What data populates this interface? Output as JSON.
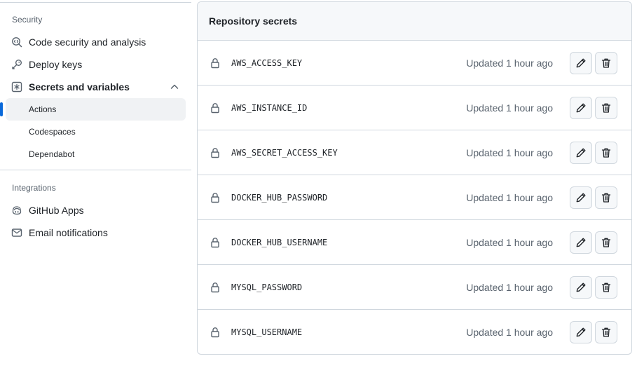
{
  "sidebar": {
    "security_heading": "Security",
    "items": [
      {
        "label": "Code security and analysis",
        "icon": "codescan-icon"
      },
      {
        "label": "Deploy keys",
        "icon": "key-icon"
      },
      {
        "label": "Secrets and variables",
        "icon": "asterisk-square-icon",
        "expanded": true
      },
      {
        "label": "Actions",
        "active": true
      },
      {
        "label": "Codespaces"
      },
      {
        "label": "Dependabot"
      }
    ],
    "integrations_heading": "Integrations",
    "integration_items": [
      {
        "label": "GitHub Apps",
        "icon": "copilot-app-icon"
      },
      {
        "label": "Email notifications",
        "icon": "mail-icon"
      }
    ]
  },
  "secrets": {
    "title": "Repository secrets",
    "rows": [
      {
        "name": "AWS_ACCESS_KEY",
        "updated": "Updated 1 hour ago"
      },
      {
        "name": "AWS_INSTANCE_ID",
        "updated": "Updated 1 hour ago"
      },
      {
        "name": "AWS_SECRET_ACCESS_KEY",
        "updated": "Updated 1 hour ago"
      },
      {
        "name": "DOCKER_HUB_PASSWORD",
        "updated": "Updated 1 hour ago"
      },
      {
        "name": "DOCKER_HUB_USERNAME",
        "updated": "Updated 1 hour ago"
      },
      {
        "name": "MYSQL_PASSWORD",
        "updated": "Updated 1 hour ago"
      },
      {
        "name": "MYSQL_USERNAME",
        "updated": "Updated 1 hour ago"
      }
    ]
  },
  "colors": {
    "accent": "#0969da",
    "border": "#d0d7de",
    "muted_text": "#59636e",
    "header_bg": "#f6f8fa",
    "active_bg": "#f0f2f4"
  }
}
